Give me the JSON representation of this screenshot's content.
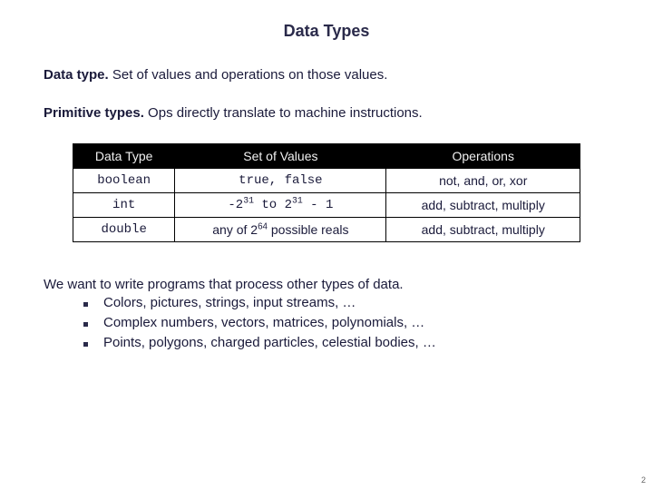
{
  "title": "Data Types",
  "definition": {
    "term": "Data type.",
    "body": "  Set of values and operations on those values."
  },
  "primitive": {
    "term": "Primitive types.",
    "body": "  Ops directly translate to machine instructions."
  },
  "table": {
    "headers": [
      "Data Type",
      "Set of Values",
      "Operations"
    ],
    "rows": [
      {
        "type_html": "boolean",
        "type_mono": true,
        "values_html": "true, false",
        "values_mono": true,
        "ops": "not, and, or, xor"
      },
      {
        "type_html": "int",
        "type_mono": true,
        "values_html": "-2<sup>31</sup> to 2<sup>31</sup> - 1",
        "values_mono": true,
        "ops": "add, subtract, multiply"
      },
      {
        "type_html": "double",
        "type_mono": true,
        "values_html": "any of 2<sup>64</sup> possible reals",
        "values_mono": false,
        "ops": "add, subtract, multiply"
      }
    ]
  },
  "want": {
    "lead": "We want to write programs that process other types of data.",
    "items": [
      "Colors, pictures, strings, input streams, …",
      "Complex numbers, vectors, matrices, polynomials, …",
      "Points, polygons, charged particles, celestial bodies, …"
    ]
  },
  "page_number": "2"
}
